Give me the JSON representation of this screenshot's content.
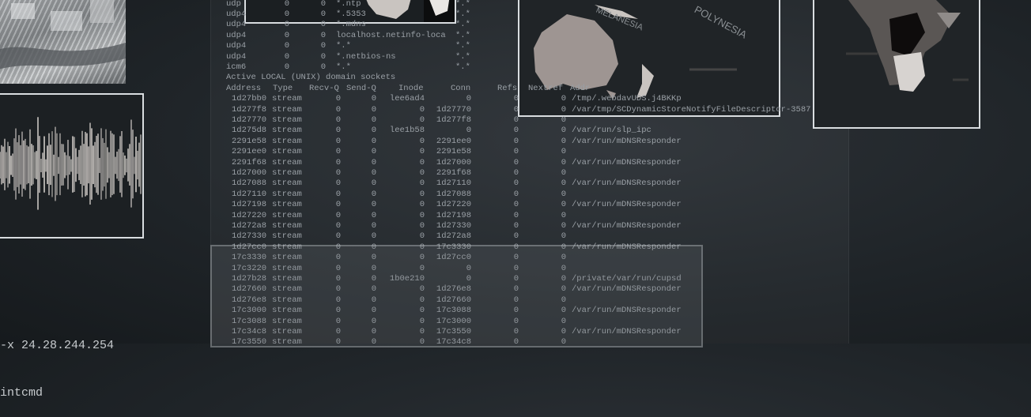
{
  "top_partial_lines": [
    {
      "proto": "udp",
      "recv": "0",
      "send": "0",
      "local": "*.ntp",
      "foreign": "*.*"
    },
    {
      "proto": "udp4",
      "recv": "0",
      "send": "0",
      "local": "*.5353",
      "foreign": "*.*"
    },
    {
      "proto": "udp4",
      "recv": "0",
      "send": "0",
      "local": "*.mdns",
      "foreign": "*.*"
    },
    {
      "proto": "udp4",
      "recv": "0",
      "send": "0",
      "local": "localhost.netinfo-loca",
      "foreign": "*.*"
    },
    {
      "proto": "udp4",
      "recv": "0",
      "send": "0",
      "local": "*.*",
      "foreign": "*.*"
    },
    {
      "proto": "udp4",
      "recv": "0",
      "send": "0",
      "local": "*.netbios-ns",
      "foreign": "*.*"
    },
    {
      "proto": "icm6",
      "recv": "0",
      "send": "0",
      "local": "*.*",
      "foreign": "*.*"
    }
  ],
  "section_title": "Active LOCAL (UNIX) domain sockets",
  "headers": [
    "Address",
    "Type",
    "Recv-Q",
    "Send-Q",
    "Inode",
    "Conn",
    "Refs",
    "Nextref",
    "Addr"
  ],
  "rows": [
    [
      "1d27bb0",
      "stream",
      "0",
      "0",
      "lee6ad4",
      "0",
      "0",
      "0",
      "/tmp/.webdavUDS.j4BKKp"
    ],
    [
      "1d277f8",
      "stream",
      "0",
      "0",
      "0",
      "1d27770",
      "0",
      "0",
      "/var/tmp/SCDynamicStoreNotifyFileDescriptor-3587"
    ],
    [
      "1d27770",
      "stream",
      "0",
      "0",
      "0",
      "1d277f8",
      "0",
      "0",
      ""
    ],
    [
      "1d275d8",
      "stream",
      "0",
      "0",
      "lee1b58",
      "0",
      "0",
      "0",
      "/var/run/slp_ipc"
    ],
    [
      "2291e58",
      "stream",
      "0",
      "0",
      "0",
      "2291ee0",
      "0",
      "0",
      "/var/run/mDNSResponder"
    ],
    [
      "2291ee0",
      "stream",
      "0",
      "0",
      "0",
      "2291e58",
      "0",
      "0",
      ""
    ],
    [
      "2291f68",
      "stream",
      "0",
      "0",
      "0",
      "1d27000",
      "0",
      "0",
      "/var/run/mDNSResponder"
    ],
    [
      "1d27000",
      "stream",
      "0",
      "0",
      "0",
      "2291f68",
      "0",
      "0",
      ""
    ],
    [
      "1d27088",
      "stream",
      "0",
      "0",
      "0",
      "1d27110",
      "0",
      "0",
      "/var/run/mDNSResponder"
    ],
    [
      "1d27110",
      "stream",
      "0",
      "0",
      "0",
      "1d27088",
      "0",
      "0",
      ""
    ],
    [
      "1d27198",
      "stream",
      "0",
      "0",
      "0",
      "1d27220",
      "0",
      "0",
      "/var/run/mDNSResponder"
    ],
    [
      "1d27220",
      "stream",
      "0",
      "0",
      "0",
      "1d27198",
      "0",
      "0",
      ""
    ],
    [
      "1d272a8",
      "stream",
      "0",
      "0",
      "0",
      "1d27330",
      "0",
      "0",
      "/var/run/mDNSResponder"
    ],
    [
      "1d27330",
      "stream",
      "0",
      "0",
      "0",
      "1d272a8",
      "0",
      "0",
      ""
    ],
    [
      "1d27cc0",
      "stream",
      "0",
      "0",
      "0",
      "17c3330",
      "0",
      "0",
      "/var/run/mDNSResponder"
    ],
    [
      "17c3330",
      "stream",
      "0",
      "0",
      "0",
      "1d27cc0",
      "0",
      "0",
      ""
    ],
    [
      "17c3220",
      "stream",
      "0",
      "0",
      "0",
      "0",
      "0",
      "0",
      ""
    ],
    [
      "1d27b28",
      "stream",
      "0",
      "0",
      "1b0e210",
      "0",
      "0",
      "0",
      "/private/var/run/cupsd"
    ],
    [
      "1d27660",
      "stream",
      "0",
      "0",
      "0",
      "1d276e8",
      "0",
      "0",
      "/var/run/mDNSResponder"
    ],
    [
      "1d276e8",
      "stream",
      "0",
      "0",
      "0",
      "1d27660",
      "0",
      "0",
      ""
    ],
    [
      "17c3000",
      "stream",
      "0",
      "0",
      "0",
      "17c3088",
      "0",
      "0",
      "/var/run/mDNSResponder"
    ],
    [
      "17c3088",
      "stream",
      "0",
      "0",
      "0",
      "17c3000",
      "0",
      "0",
      ""
    ],
    [
      "17c34c8",
      "stream",
      "0",
      "0",
      "0",
      "17c3550",
      "0",
      "0",
      "/var/run/mDNSResponder"
    ],
    [
      "17c3550",
      "stream",
      "0",
      "0",
      "0",
      "17c34c8",
      "0",
      "0",
      ""
    ]
  ],
  "map_labels": {
    "melanesia": "MELANESIA",
    "polynesia": "POLYNESIA"
  },
  "bottom_commands": [
    "-x 24.28.244.254",
    "intcmd"
  ],
  "colors": {
    "terminal_text": "#9aa0a6",
    "frame": "#d9dde0",
    "background": "#1f2428"
  }
}
